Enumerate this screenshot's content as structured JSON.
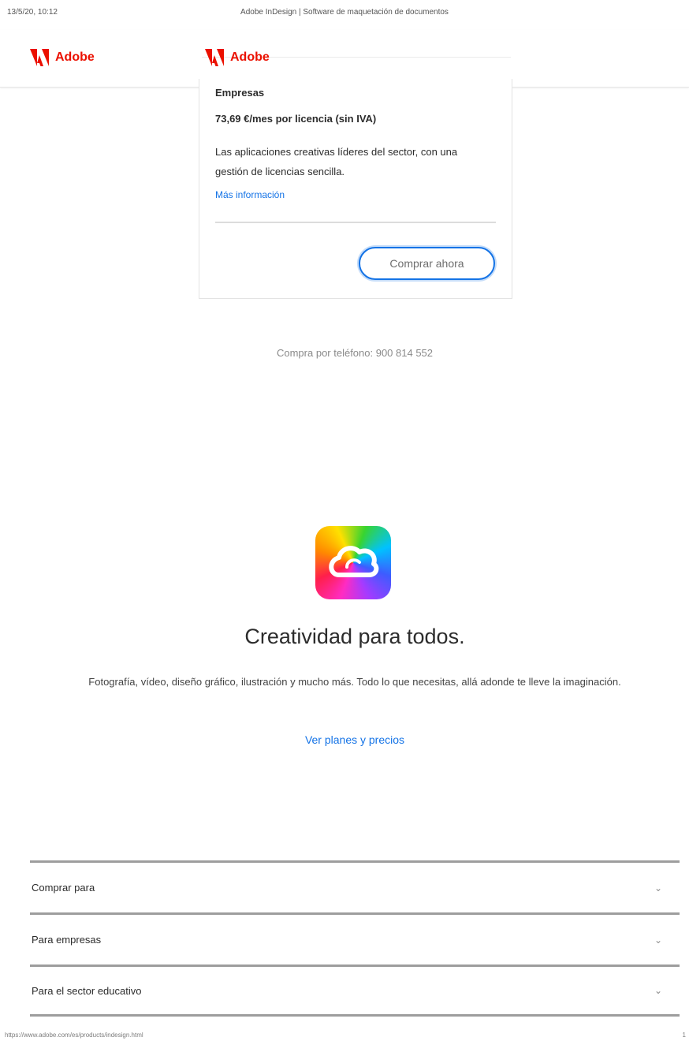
{
  "print_header": {
    "datetime": "13/5/20, 10:12",
    "title": "Adobe InDesign | Software de maquetación de documentos"
  },
  "brand": {
    "name": "Adobe",
    "accent": "#EB1000",
    "link_color": "#1473E6"
  },
  "plan_card": {
    "plan_name": "Empresas",
    "price": "73,69 €/mes por licencia (sin IVA)",
    "description": "Las aplicaciones creativas líderes del sector, con una gestión de licencias sencilla.",
    "more_info_link": "Más información",
    "buy_button": "Comprar ahora"
  },
  "phone_purchase": "Compra por teléfono: 900 814 552",
  "promo": {
    "icon": "creative-cloud-icon",
    "headline": "Creatividad para todos.",
    "subtext": "Fotografía, vídeo, diseño gráfico, ilustración y mucho más. Todo lo que necesitas, allá adonde te lleve la imaginación.",
    "link": "Ver planes y precios"
  },
  "footer_accordion": {
    "items": [
      {
        "label": "Comprar para",
        "icon": "chevron-down-icon"
      },
      {
        "label": "Para empresas",
        "icon": "chevron-down-icon"
      },
      {
        "label": "Para el sector educativo",
        "icon": "chevron-down-icon"
      }
    ]
  },
  "print_footer": {
    "url": "https://www.adobe.com/es/products/indesign.html",
    "page": "1"
  }
}
